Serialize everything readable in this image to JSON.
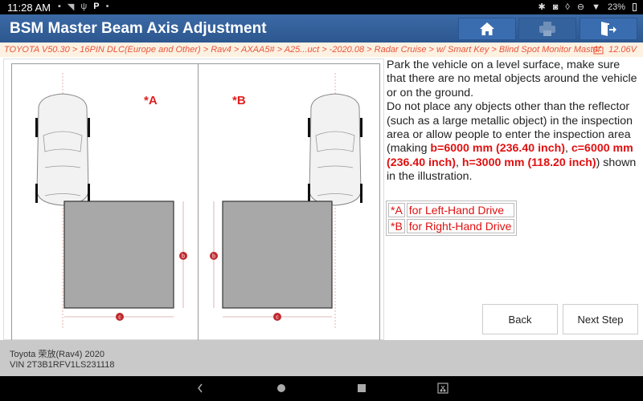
{
  "status_bar": {
    "time": "11:28 AM",
    "left_icons": [
      "image-icon",
      "wifi-off-icon",
      "usb-icon",
      "parking-icon",
      "dot-icon"
    ],
    "right_icons": [
      "bluetooth-icon",
      "vibrate-icon",
      "location-icon",
      "dnd-icon",
      "wifi-icon"
    ],
    "battery": "23%"
  },
  "header": {
    "title": "BSM Master Beam Axis Adjustment",
    "buttons": [
      {
        "name": "home",
        "icon": "home-icon",
        "enabled": true
      },
      {
        "name": "print",
        "icon": "printer-icon",
        "enabled": false
      },
      {
        "name": "exit",
        "icon": "exit-icon",
        "enabled": true
      }
    ]
  },
  "breadcrumb": {
    "path": "TOYOTA V50.30 > 16PIN DLC(Europe and Other) > Rav4 > AXAA5# > A25...uct > -2020.08 > Radar Cruise > w/ Smart Key > Blind Spot Monitor Master",
    "voltage": "12.06V"
  },
  "illustration": {
    "panel_a_label": "*A",
    "panel_b_label": "*B",
    "dim_b": "b",
    "dim_c": "c"
  },
  "instructions": {
    "p1": "Park the vehicle on a level surface, make sure that there are no metal objects around the vehicle or on the ground.",
    "p2_start": "Do not place any objects other than the reflector (such as a large metallic object) in the inspection area or allow people to enter the inspection area (making ",
    "hl1": "b=6000 mm (236.40 inch)",
    "sep1": ", ",
    "hl2": "c=6000 mm (236.40 inch)",
    "sep2": ", ",
    "hl3": "h=3000 mm (118.20 inch)",
    "p2_end": ") shown in the illustration."
  },
  "legend": [
    {
      "key": "*A",
      "value": "for Left-Hand Drive"
    },
    {
      "key": "*B",
      "value": "for Right-Hand Drive"
    }
  ],
  "actions": {
    "back": "Back",
    "next": "Next Step"
  },
  "footer": {
    "vehicle": "Toyota 荣放(Rav4) 2020",
    "vin": "VIN 2T3B1RFV1LS231118"
  },
  "navbar": [
    "back-nav-icon",
    "home-nav-icon",
    "recents-nav-icon",
    "screenshot-icon"
  ]
}
